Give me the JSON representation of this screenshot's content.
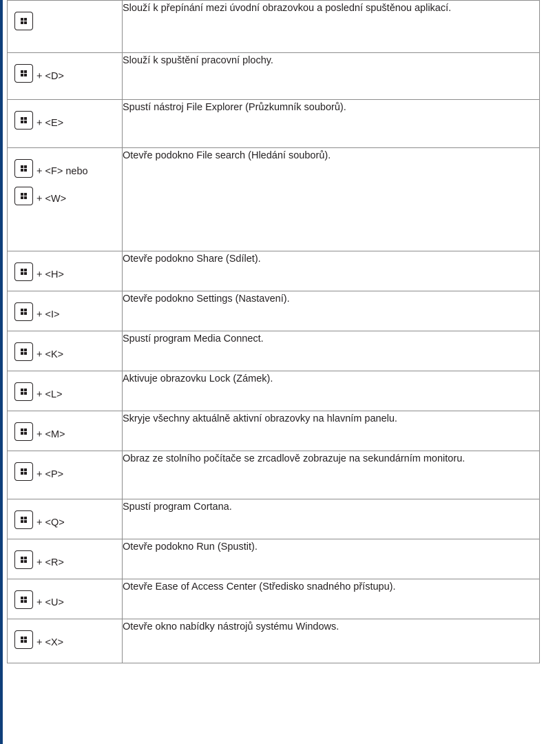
{
  "shortcuts": [
    {
      "keys": [
        {
          "icon": "windows-logo-key",
          "suffix": ""
        }
      ],
      "description": "Slouží k přepínání mezi úvodní obrazovkou a poslední spuštěnou aplikací."
    },
    {
      "keys": [
        {
          "icon": "windows-logo-key",
          "suffix": "+ <D>"
        }
      ],
      "description": "Slouží k spuštění pracovní plochy."
    },
    {
      "keys": [
        {
          "icon": "windows-logo-key",
          "suffix": "+ <E>"
        }
      ],
      "description": "Spustí nástroj File Explorer (Průzkumník souborů)."
    },
    {
      "keys": [
        {
          "icon": "windows-logo-key",
          "suffix": "+ <F> nebo"
        },
        {
          "icon": "windows-logo-key",
          "suffix": "+ <W>"
        }
      ],
      "description": "Otevře podokno File search (Hledání souborů)."
    },
    {
      "keys": [
        {
          "icon": "windows-logo-key",
          "suffix": "+ <H>"
        }
      ],
      "description": "Otevře podokno Share (Sdílet)."
    },
    {
      "keys": [
        {
          "icon": "windows-logo-key",
          "suffix": "+ <I>"
        }
      ],
      "description": "Otevře podokno Settings (Nastavení)."
    },
    {
      "keys": [
        {
          "icon": "windows-logo-key",
          "suffix": "+ <K>"
        }
      ],
      "description": "Spustí program Media Connect."
    },
    {
      "keys": [
        {
          "icon": "windows-logo-key",
          "suffix": "+ <L>"
        }
      ],
      "description": "Aktivuje obrazovku Lock (Zámek)."
    },
    {
      "keys": [
        {
          "icon": "windows-logo-key",
          "suffix": "+ <M>"
        }
      ],
      "description": "Skryje všechny aktuálně aktivní obrazovky na hlavním panelu."
    },
    {
      "keys": [
        {
          "icon": "windows-logo-key",
          "suffix": "+ <P>"
        }
      ],
      "description": "Obraz ze stolního počítače se zrcadlově zobrazuje na sekundárním monitoru."
    },
    {
      "keys": [
        {
          "icon": "windows-logo-key",
          "suffix": "+ <Q>"
        }
      ],
      "description": "Spustí program Cortana."
    },
    {
      "keys": [
        {
          "icon": "windows-logo-key",
          "suffix": "+ <R>"
        }
      ],
      "description": "Otevře podokno Run (Spustit)."
    },
    {
      "keys": [
        {
          "icon": "windows-logo-key",
          "suffix": "+ <U>"
        }
      ],
      "description": "Otevře Ease of Access Center (Středisko snadného přístupu)."
    },
    {
      "keys": [
        {
          "icon": "windows-logo-key",
          "suffix": "+ <X>"
        }
      ],
      "description": "Otevře okno nabídky nástrojů systému Windows."
    }
  ],
  "colors": {
    "accent_bar": "#0f3f7a",
    "grid_line": "#8c8c8c",
    "text": "#231f20"
  }
}
